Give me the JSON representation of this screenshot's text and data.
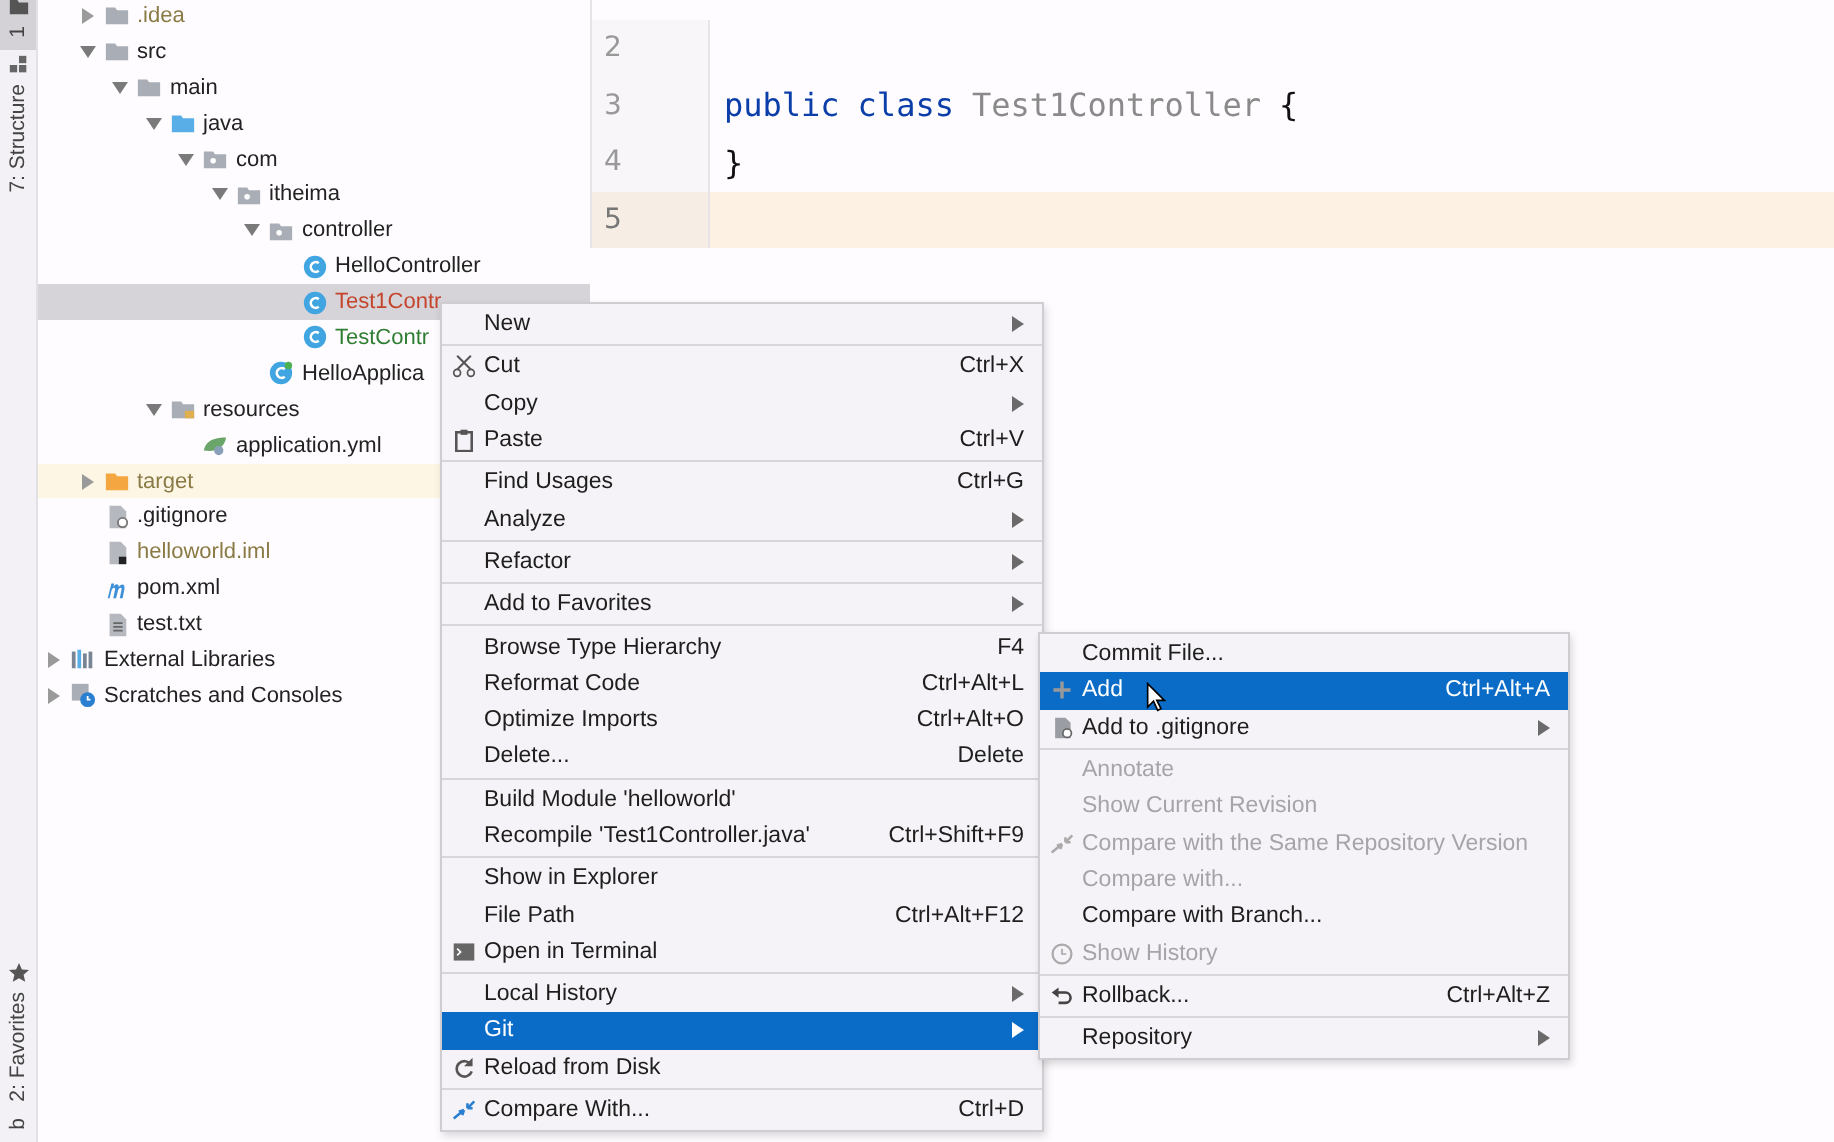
{
  "tool_strip": {
    "top": [
      {
        "label": "1",
        "selected": true,
        "kind": "folder"
      },
      {
        "label": "7: Structure",
        "selected": false,
        "kind": "structure"
      }
    ],
    "bottom": [
      {
        "label": "2: Favorites",
        "selected": false,
        "kind": "star"
      },
      {
        "label": "b",
        "selected": false
      }
    ]
  },
  "project_tree": {
    "items": [
      {
        "label": ".idea",
        "kind": "folder",
        "expanded": false,
        "color": "#8a7a45",
        "selected": false
      },
      {
        "label": "src",
        "kind": "folder",
        "expanded": true,
        "color": "#222222",
        "selected": false,
        "children": [
          {
            "label": "main",
            "kind": "folder",
            "expanded": true,
            "color": "#222222",
            "selected": false,
            "children": [
              {
                "label": "java",
                "kind": "source-folder",
                "expanded": true,
                "color": "#222222",
                "selected": false,
                "children": [
                  {
                    "label": "com",
                    "kind": "package",
                    "expanded": true,
                    "color": "#222222",
                    "selected": false,
                    "children": [
                      {
                        "label": "itheima",
                        "kind": "package",
                        "expanded": true,
                        "color": "#222222",
                        "selected": false,
                        "children": [
                          {
                            "label": "controller",
                            "kind": "package",
                            "expanded": true,
                            "color": "#222222",
                            "selected": false,
                            "children": [
                              {
                                "label": "HelloController",
                                "kind": "class",
                                "color": "#222222",
                                "selected": false
                              },
                              {
                                "label": "Test1Contr",
                                "kind": "class",
                                "color": "#c4452c",
                                "selected": true
                              },
                              {
                                "label": "TestContr",
                                "kind": "class",
                                "color": "#2e7d32",
                                "selected": false
                              }
                            ]
                          },
                          {
                            "label": "HelloApplica",
                            "kind": "spring-class",
                            "color": "#222222",
                            "selected": false
                          }
                        ]
                      }
                    ]
                  }
                ]
              },
              {
                "label": "resources",
                "kind": "resources-folder",
                "expanded": true,
                "color": "#222222",
                "selected": false,
                "children": [
                  {
                    "label": "application.yml",
                    "kind": "yaml",
                    "color": "#222222",
                    "selected": false
                  }
                ]
              }
            ]
          }
        ]
      },
      {
        "label": "target",
        "kind": "excluded-folder",
        "expanded": false,
        "color": "#8a7a45",
        "selected": false
      },
      {
        "label": ".gitignore",
        "kind": "ignore-file",
        "color": "#222222",
        "selected": false
      },
      {
        "label": "helloworld.iml",
        "kind": "module-file",
        "color": "#8a7a45",
        "selected": false
      },
      {
        "label": "pom.xml",
        "kind": "maven",
        "color": "#222222",
        "selected": false
      },
      {
        "label": "test.txt",
        "kind": "text-file",
        "color": "#222222",
        "selected": false
      }
    ],
    "top_level": [
      {
        "label": "External Libraries",
        "kind": "libraries",
        "expanded": false,
        "color": "#222222",
        "selected": false
      },
      {
        "label": "Scratches and Consoles",
        "kind": "scratches",
        "expanded": false,
        "color": "#222222",
        "selected": false
      }
    ]
  },
  "editor": {
    "lines": [
      {
        "number": "2",
        "current": false
      },
      {
        "number": "3",
        "current": false,
        "tokens": [
          {
            "text": "public",
            "kind": "keyword"
          },
          {
            "text": "class",
            "kind": "keyword"
          },
          {
            "text": "Test1Controller",
            "kind": "class-name"
          },
          {
            "text": "{",
            "kind": "plain"
          }
        ]
      },
      {
        "number": "4",
        "current": false,
        "tokens": [
          {
            "text": "}",
            "kind": "plain"
          }
        ]
      },
      {
        "number": "5",
        "current": true
      }
    ]
  },
  "context_menu": {
    "groups": [
      [
        {
          "label": "New",
          "submenu": true,
          "selected": false
        }
      ],
      [
        {
          "label": "Cut",
          "kind": "cut",
          "shortcut": "Ctrl+X",
          "selected": false
        },
        {
          "label": "Copy",
          "submenu": true,
          "selected": false
        },
        {
          "label": "Paste",
          "kind": "paste",
          "shortcut": "Ctrl+V",
          "selected": false
        }
      ],
      [
        {
          "label": "Find Usages",
          "shortcut": "Ctrl+G",
          "selected": false
        },
        {
          "label": "Analyze",
          "submenu": true,
          "selected": false
        }
      ],
      [
        {
          "label": "Refactor",
          "submenu": true,
          "selected": false
        }
      ],
      [
        {
          "label": "Add to Favorites",
          "submenu": true,
          "selected": false
        }
      ],
      [
        {
          "label": "Browse Type Hierarchy",
          "shortcut": "F4",
          "selected": false
        },
        {
          "label": "Reformat Code",
          "shortcut": "Ctrl+Alt+L",
          "selected": false
        },
        {
          "label": "Optimize Imports",
          "shortcut": "Ctrl+Alt+O",
          "selected": false
        },
        {
          "label": "Delete...",
          "shortcut": "Delete",
          "selected": false
        }
      ],
      [
        {
          "label": "Build Module 'helloworld'",
          "selected": false
        },
        {
          "label": "Recompile 'Test1Controller.java'",
          "shortcut": "Ctrl+Shift+F9",
          "selected": false
        }
      ],
      [
        {
          "label": "Show in Explorer",
          "selected": false
        },
        {
          "label": "File Path",
          "shortcut": "Ctrl+Alt+F12",
          "selected": false
        },
        {
          "label": "Open in Terminal",
          "kind": "terminal",
          "selected": false
        }
      ],
      [
        {
          "label": "Local History",
          "submenu": true,
          "selected": false
        },
        {
          "label": "Git",
          "submenu": true,
          "selected": true
        },
        {
          "label": "Reload from Disk",
          "kind": "reload",
          "selected": false
        }
      ],
      [
        {
          "label": "Compare With...",
          "kind": "compare",
          "shortcut": "Ctrl+D",
          "selected": false
        }
      ]
    ]
  },
  "git_submenu": {
    "groups": [
      [
        {
          "label": "Commit File...",
          "disabled": false,
          "selected": false
        },
        {
          "label": "Add",
          "kind": "add",
          "shortcut": "Ctrl+Alt+A",
          "disabled": false,
          "selected": true
        },
        {
          "label": "Add to .gitignore",
          "kind": "ignore-file",
          "submenu": true,
          "disabled": false,
          "selected": false
        }
      ],
      [
        {
          "label": "Annotate",
          "disabled": true,
          "selected": false
        },
        {
          "label": "Show Current Revision",
          "disabled": true,
          "selected": false
        },
        {
          "label": "Compare with the Same Repository Version",
          "kind": "compare",
          "disabled": true,
          "selected": false
        },
        {
          "label": "Compare with...",
          "disabled": true,
          "selected": false
        },
        {
          "label": "Compare with Branch...",
          "disabled": false,
          "selected": false
        },
        {
          "label": "Show History",
          "kind": "history",
          "disabled": true,
          "selected": false
        }
      ],
      [
        {
          "label": "Rollback...",
          "kind": "rollback",
          "shortcut": "Ctrl+Alt+Z",
          "disabled": false,
          "selected": false
        }
      ],
      [
        {
          "label": "Repository",
          "submenu": true,
          "disabled": false,
          "selected": false
        }
      ]
    ]
  }
}
